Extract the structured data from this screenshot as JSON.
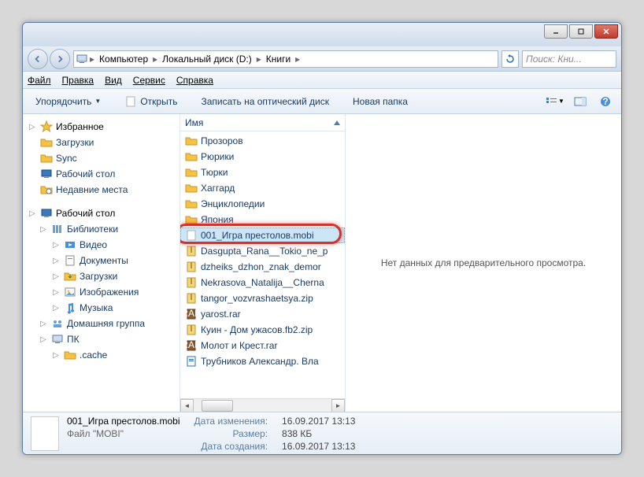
{
  "breadcrumb": {
    "items": [
      "Компьютер",
      "Локальный диск (D:)",
      "Книги"
    ]
  },
  "search": {
    "placeholder": "Поиск: Кни..."
  },
  "menubar": {
    "items": [
      "Файл",
      "Правка",
      "Вид",
      "Сервис",
      "Справка"
    ]
  },
  "toolbar": {
    "organize": "Упорядочить",
    "open": "Открыть",
    "burn": "Записать на оптический диск",
    "newfolder": "Новая папка"
  },
  "sidebar": {
    "favorites": {
      "label": "Избранное",
      "items": [
        "Загрузки",
        "Sync",
        "Рабочий стол",
        "Недавние места"
      ]
    },
    "desktop": {
      "label": "Рабочий стол",
      "items": [
        {
          "label": "Библиотеки",
          "icon": "lib"
        },
        {
          "label": "Видео",
          "icon": "vid",
          "indent": 1
        },
        {
          "label": "Документы",
          "icon": "doc",
          "indent": 1
        },
        {
          "label": "Загрузки",
          "icon": "dl",
          "indent": 1
        },
        {
          "label": "Изображения",
          "icon": "img",
          "indent": 1
        },
        {
          "label": "Музыка",
          "icon": "mus",
          "indent": 1
        },
        {
          "label": "Домашняя группа",
          "icon": "hg"
        },
        {
          "label": "ПК",
          "icon": "pc"
        },
        {
          "label": ".cache",
          "icon": "folder",
          "indent": 1
        }
      ]
    }
  },
  "filepane": {
    "header": "Имя",
    "items": [
      {
        "name": "Прозоров",
        "type": "folder"
      },
      {
        "name": "Рюрики",
        "type": "folder"
      },
      {
        "name": "Тюрки",
        "type": "folder"
      },
      {
        "name": "Хаггард",
        "type": "folder"
      },
      {
        "name": "Энциклопедии",
        "type": "folder"
      },
      {
        "name": "Япония",
        "type": "folder"
      },
      {
        "name": "001_Игра престолов.mobi",
        "type": "file",
        "selected": true,
        "highlighted": true
      },
      {
        "name": "Dasgupta_Rana__Tokio_ne_p",
        "type": "zip"
      },
      {
        "name": "dzheiks_dzhon_znak_demor",
        "type": "zip"
      },
      {
        "name": "Nekrasova_Natalija__Cherna",
        "type": "zip"
      },
      {
        "name": "tangor_vozvrashaetsya.zip",
        "type": "zip"
      },
      {
        "name": "yarost.rar",
        "type": "rar"
      },
      {
        "name": "Куин - Дом ужасов.fb2.zip",
        "type": "zip"
      },
      {
        "name": "Молот и Крест.rar",
        "type": "rar"
      },
      {
        "name": "Трубников Александр. Вла",
        "type": "doc"
      }
    ]
  },
  "preview": {
    "empty": "Нет данных для предварительного просмотра."
  },
  "status": {
    "filename": "001_Игра престолов.mobi",
    "filetype": "Файл \"MOBI\"",
    "modified_lbl": "Дата изменения:",
    "modified": "16.09.2017 13:13",
    "size_lbl": "Размер:",
    "size": "838 КБ",
    "created_lbl": "Дата создания:",
    "created": "16.09.2017 13:13"
  }
}
